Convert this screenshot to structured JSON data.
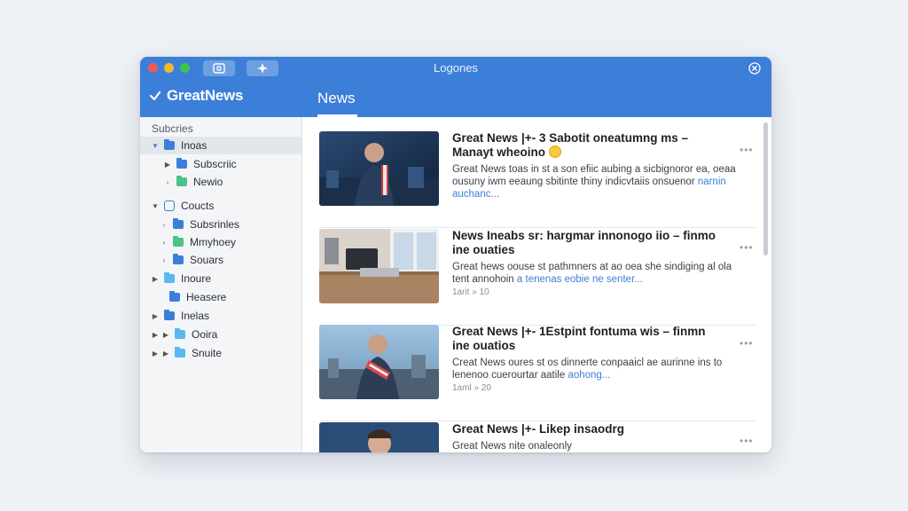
{
  "window": {
    "title": "Logones"
  },
  "brand": {
    "name": "GreatNews"
  },
  "header": {
    "tab_label": "News"
  },
  "sidebar": {
    "heading": "Subcries",
    "items": [
      {
        "label": "Inoas",
        "color": "#3c7fd8",
        "expanded": true,
        "selected": true
      },
      {
        "label": "Subscriic",
        "color": "#3c7fd8"
      },
      {
        "label": "Newio",
        "color": "#4cc38a"
      },
      {
        "label": "Coucts",
        "color": "#3c7fd8",
        "expanded": true
      },
      {
        "label": "Subsrinles",
        "color": "#3c7fd8"
      },
      {
        "label": "Mmyhoey",
        "color": "#4cc38a"
      },
      {
        "label": "Souars",
        "color": "#3c7fd8"
      },
      {
        "label": "Inoure",
        "color": "#5ab8ef"
      },
      {
        "label": "Heasere",
        "color": "#3c7fd8"
      },
      {
        "label": "Inelas",
        "color": "#3c7fd8"
      },
      {
        "label": "Ooira",
        "color": "#5ab8ef"
      },
      {
        "label": "Snuite",
        "color": "#5ab8ef"
      }
    ]
  },
  "articles": [
    {
      "title": "Great News |+- 3 Sabotit oneatumng ms – Manayt wheoino",
      "excerpt": "Great News toas in st a son efiic aubing a sicbignoror ea, oeaa ousuny iwm eeaung sbitinte thiny indicvtaiis onsuenor",
      "excerpt_link": "narnin auchanc...",
      "meta": ""
    },
    {
      "title": "News Ineabs sr: hargmar innonogo iio – finmo ine ouaties",
      "excerpt": "Great hews oouse st pathmners at ao oea she sindiging al ola tent annohoin",
      "excerpt_link": "a tenenas eobie ne senter...",
      "meta": "1arit » 10"
    },
    {
      "title": "Great News |+- 1Estpint fontuma wis – finmn ine ouatios",
      "excerpt": "Creat News oures st os dinnerte conpaaicl ae aurinne ins to lenenoo cuerourtar aatile",
      "excerpt_link": "aohong...",
      "meta": "1aml » 20"
    },
    {
      "title": "Great News |+- Likep insaodrg",
      "excerpt": "Great News nite onaleonly",
      "excerpt_link": "",
      "meta": ""
    }
  ],
  "icons": {
    "logo": "checkmark-logo-icon",
    "close": "close-icon",
    "toolbar1": "window-icon",
    "toolbar2": "compose-icon"
  }
}
